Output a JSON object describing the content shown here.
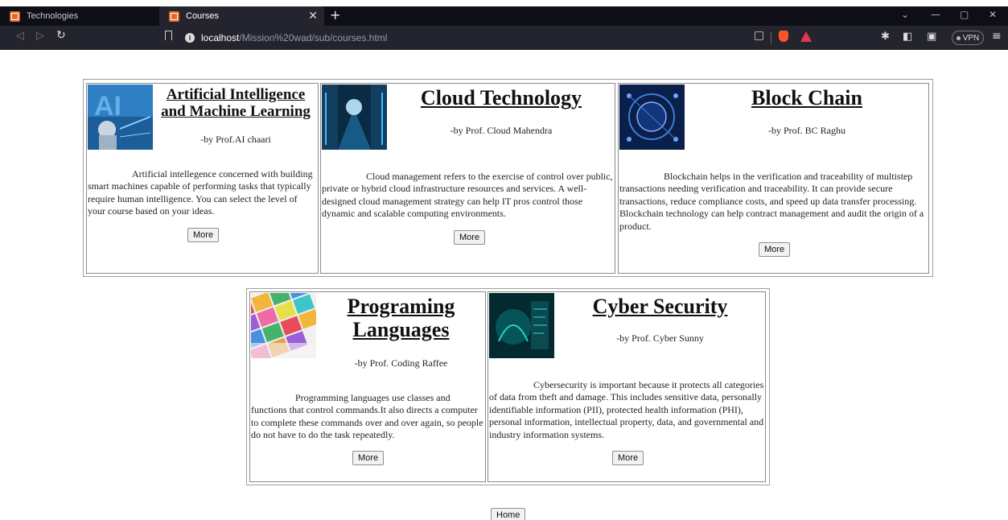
{
  "browser": {
    "tabs": [
      {
        "label": "Technologies"
      },
      {
        "label": "Courses"
      }
    ],
    "address": {
      "host": "localhost",
      "path": "/Mission%20wad/sub/courses.html"
    },
    "vpn_label": "VPN"
  },
  "courses": [
    {
      "title": "Artificial Intelligence and Machine Learning",
      "professor": "-by Prof.AI chaari",
      "description": "Artificial intellegence concerned with building smart machines capable of performing tasks that typically require human intelligence. You can select the level of your course based on your ideas.",
      "button": "More"
    },
    {
      "title": "Cloud Technology",
      "professor": "-by Prof. Cloud Mahendra",
      "description": "Cloud management refers to the exercise of control over public, private or hybrid cloud infrastructure resources and services. A well-designed cloud management strategy can help IT pros control those dynamic and scalable computing environments.",
      "button": "More"
    },
    {
      "title": "Block Chain",
      "professor": "-by Prof. BC Raghu",
      "description": "Blockchain helps in the verification and traceability of multistep transactions needing verification and traceability. It can provide secure transactions, reduce compliance costs, and speed up data transfer processing. Blockchain technology can help contract management and audit the origin of a product.",
      "button": "More"
    },
    {
      "title": "Programing Languages",
      "professor": "-by Prof. Coding Raffee",
      "description": "Programming languages use classes and functions that control commands.It also directs a computer to complete these commands over and over again, so people do not have to do the task repeatedly.",
      "button": "More"
    },
    {
      "title": "Cyber Security",
      "professor": "-by Prof. Cyber Sunny",
      "description": "Cybersecurity is important because it protects all categories of data from theft and damage. This includes sensitive data, personally identifiable information (PII), protected health information (PHI), personal information, intellectual property, data, and governmental and industry information systems.",
      "button": "More"
    }
  ],
  "home_button": "Home"
}
